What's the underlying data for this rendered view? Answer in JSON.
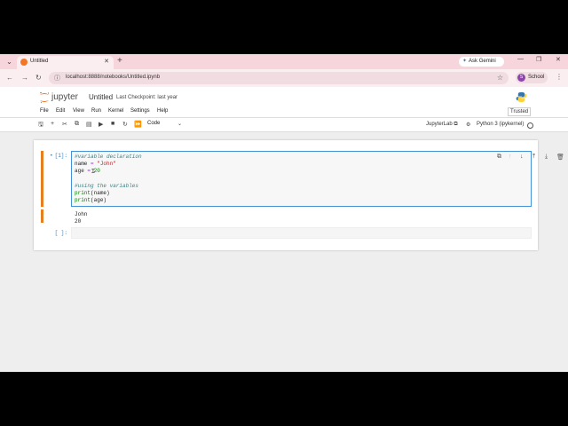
{
  "browser": {
    "tab_title": "Untitled",
    "url": "localhost:8888/notebooks/Untitled.ipynb",
    "gemini_label": "Ask Gemini",
    "profile_label": "School",
    "profile_initial": "S"
  },
  "jupyter": {
    "brand": "jupyter",
    "notebook_name": "Untitled",
    "checkpoint": "Last Checkpoint: last year",
    "menu": [
      "File",
      "Edit",
      "View",
      "Run",
      "Kernel",
      "Settings",
      "Help"
    ],
    "trusted": "Trusted",
    "cell_type": "Code",
    "jupyterlab_link": "JupyterLab",
    "kernel": "Python 3 (ipykernel)"
  },
  "cells": {
    "cell1_prompt": "[1]:",
    "code": {
      "line1": "#variable declaration",
      "line2_var": "name",
      "line2_op": " = ",
      "line2_str": "\"John\"",
      "line3_var": "age",
      "line3_op": " = ",
      "line3_num": "20",
      "line5": "#using the variables",
      "line6_fn": "print",
      "line6_arg": "(name)",
      "line7_fn": "print",
      "line7_arg": "(age)"
    },
    "output": [
      "John",
      "20"
    ],
    "cell2_prompt": "[ ]:"
  }
}
